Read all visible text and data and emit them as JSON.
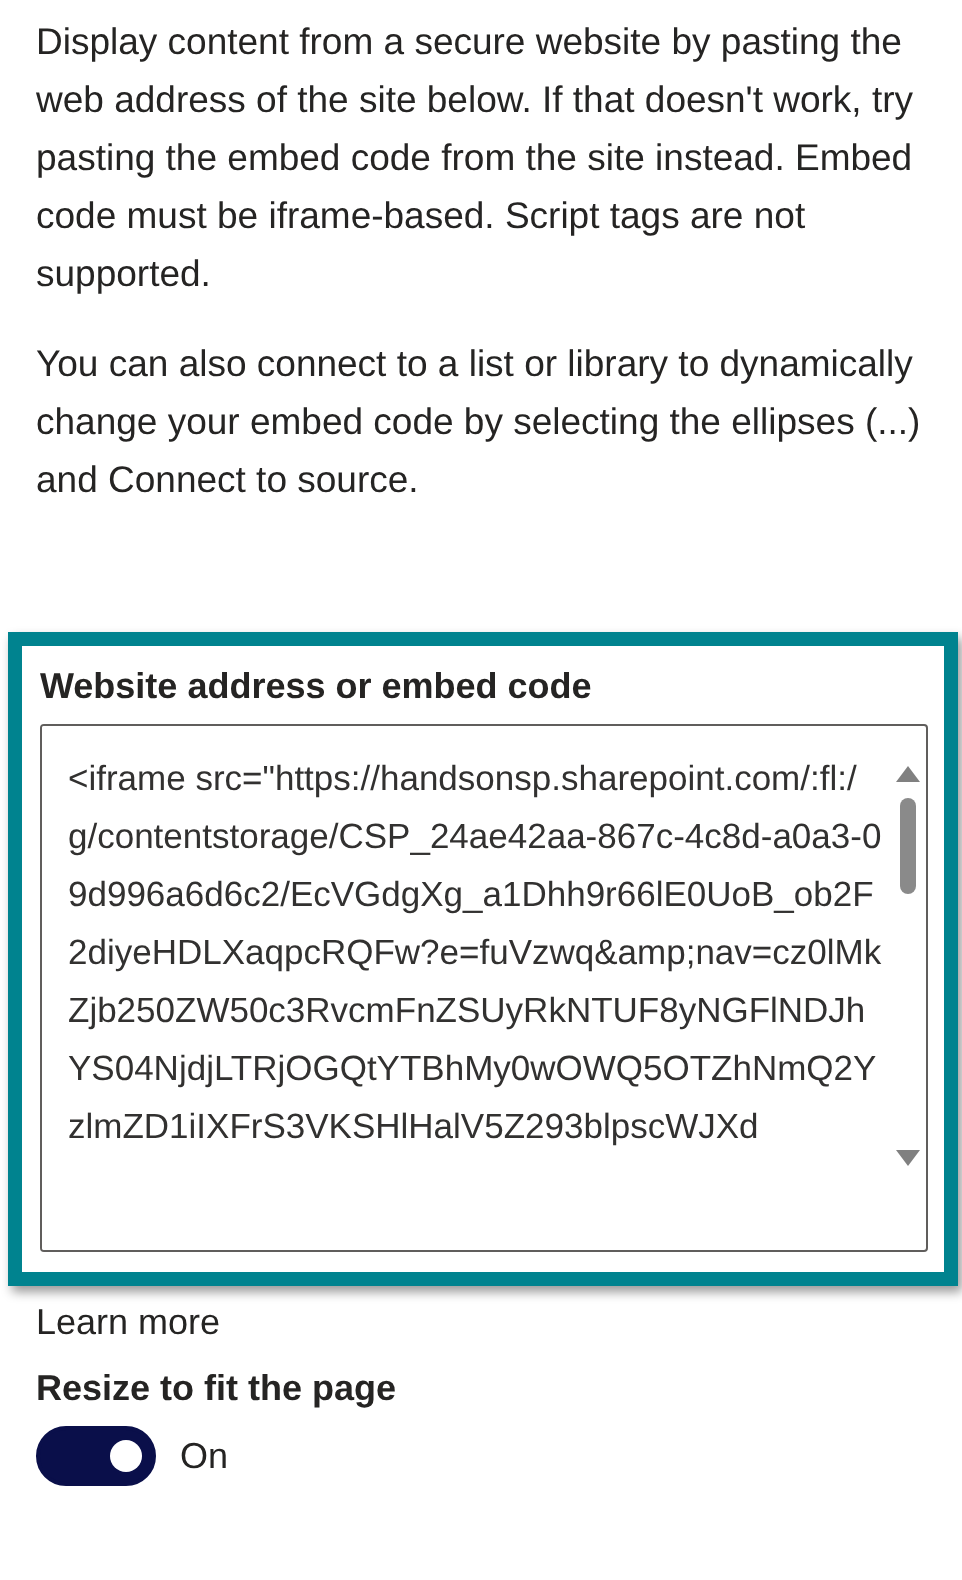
{
  "paragraphs": [
    "Display content from a secure website by pasting the web address of the site below. If that doesn't work, try pasting the embed code from the site instead. Embed code must be iframe-based. Script tags are not supported.",
    "You can also connect to a list or library to dynamically change your embed code by selecting the ellipses (...) and Connect to source."
  ],
  "embed_field": {
    "label": "Website address or embed code",
    "value": "<iframe src=\"https://handsonsp.sharepoint.com/:fl:/g/contentstorage/CSP_24ae42aa-867c-4c8d-a0a3-09d996a6d6c2/EcVGdgXg_a1Dhh9r66lE0UoB_ob2F2diyeHDLXaqpcRQFw?e=fuVzwq&amp;nav=cz0lMkZjb250ZW50c3RvcmFnZSUyRkNTUF8yNGFlNDJhYS04NjdjLTRjOGQtYTBhMy0wOWQ5OTZhNmQ2YzlmZD1iIXFrS3VKSHlHalV5Z293blpscWJXd"
  },
  "learn_more": "Learn more",
  "resize": {
    "label": "Resize to fit the page",
    "on": true,
    "state_text": "On"
  }
}
